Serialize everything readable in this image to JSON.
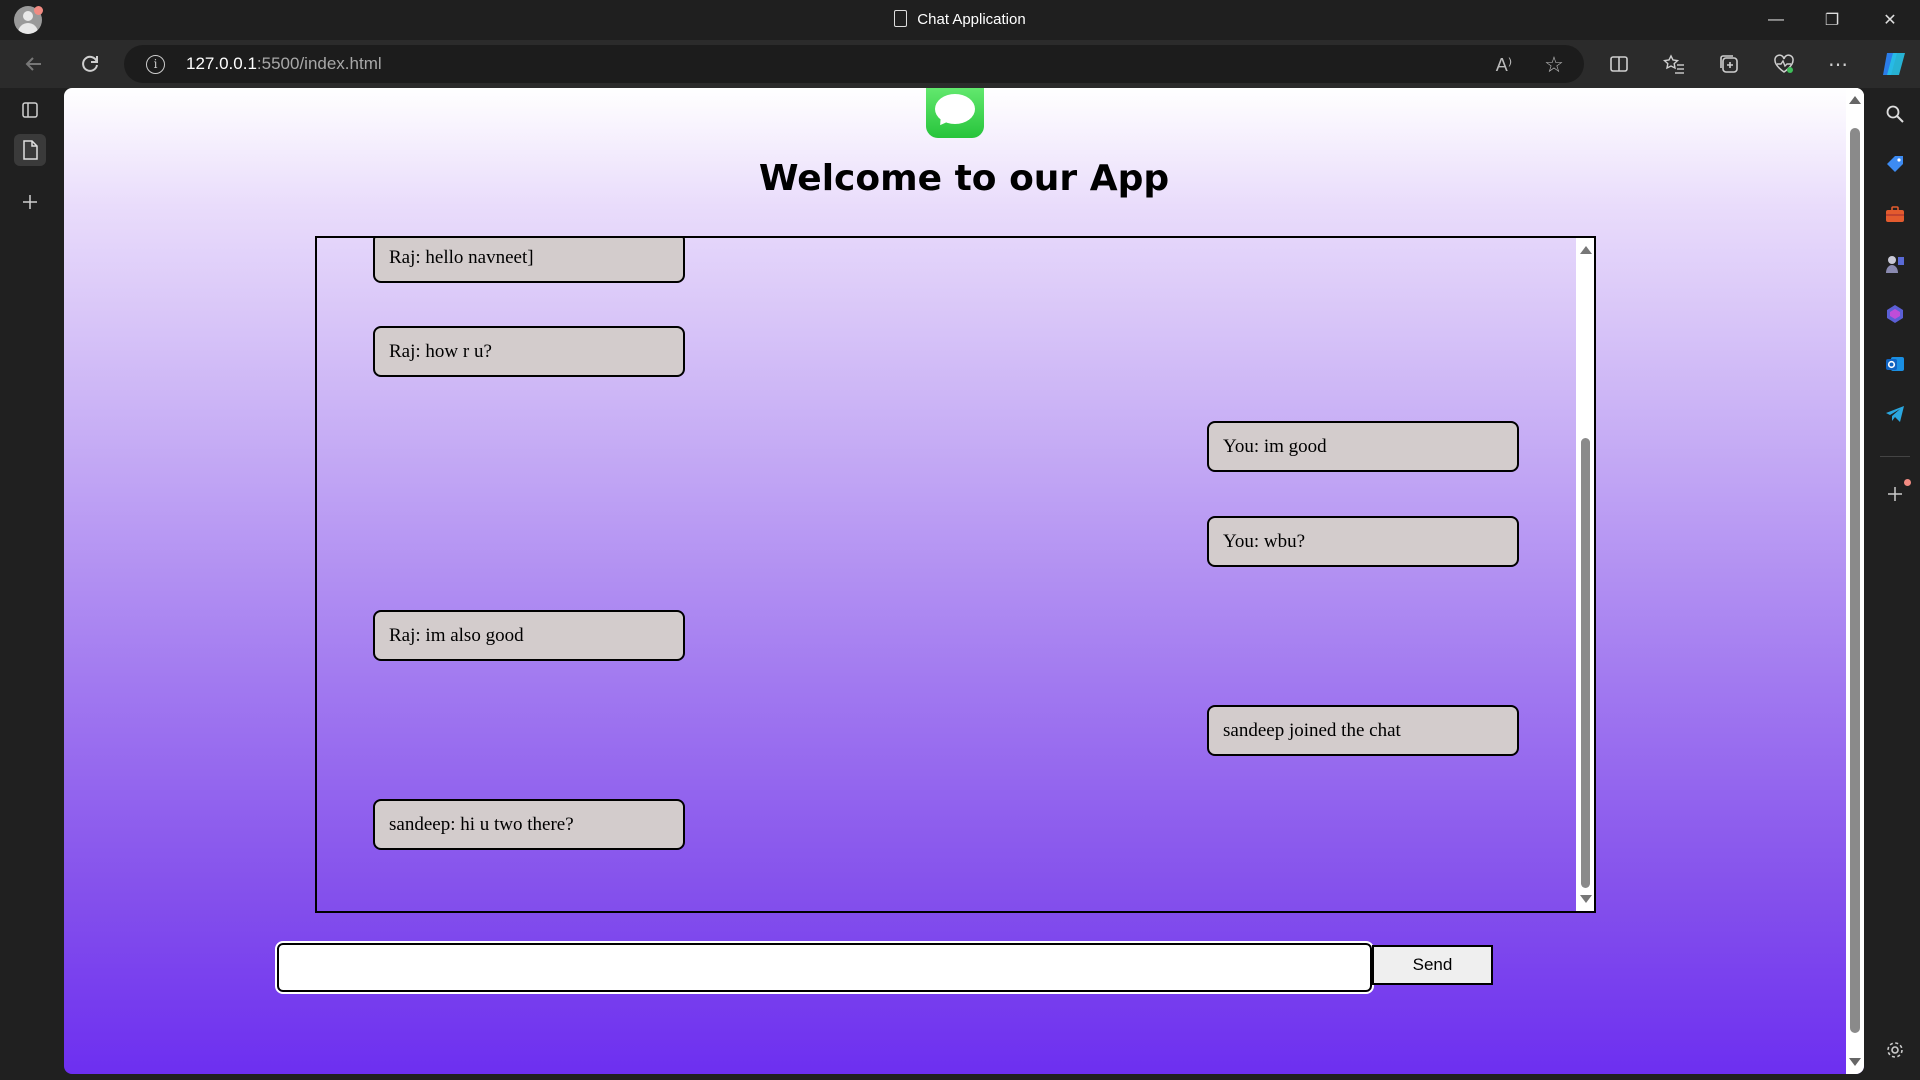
{
  "window": {
    "title": "Chat Application",
    "minimize_glyph": "—",
    "restore_glyph": "❐",
    "close_glyph": "✕"
  },
  "browser": {
    "url_host": "127.0.0.1",
    "url_path": ":5500/index.html",
    "icons": [
      "back-icon",
      "refresh-icon",
      "site-info-icon",
      "read-aloud-icon",
      "favorite-star-icon",
      "split-screen-icon",
      "favorites-icon",
      "collections-icon",
      "browser-essentials-icon",
      "more-icon",
      "copilot-icon"
    ],
    "read_aloud_glyph": "A⁾",
    "star_glyph": "☆",
    "more_glyph": "⋯"
  },
  "sidebar_right": {
    "icons": [
      "search-icon",
      "shopping-icon",
      "tools-icon",
      "games-icon",
      "microsoft-365-icon",
      "outlook-icon",
      "telegram-icon",
      "add-icon",
      "settings-icon"
    ]
  },
  "app": {
    "heading": "Welcome to our App",
    "send_label": "Send",
    "input_value": "",
    "messages": [
      {
        "text": "Raj: hello navneet]",
        "side": "left"
      },
      {
        "text": "Raj: how r u?",
        "side": "left"
      },
      {
        "text": "You: im good",
        "side": "right"
      },
      {
        "text": "You: wbu?",
        "side": "right"
      },
      {
        "text": "Raj: im also good",
        "side": "left"
      },
      {
        "text": "sandeep joined the chat",
        "side": "right"
      },
      {
        "text": "sandeep: hi u two there?",
        "side": "left"
      }
    ]
  },
  "colors": {
    "bubble": "#d3cccc",
    "gradient_top": "#ffffff",
    "gradient_bottom": "#6d2ff0",
    "app_icon": "#27c43b"
  }
}
